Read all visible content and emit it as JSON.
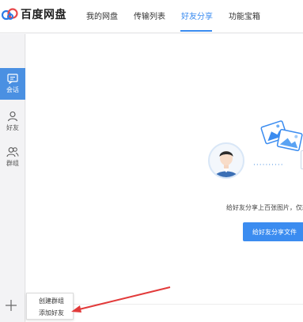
{
  "app": {
    "logo_text": "百度网盘",
    "brand_color": "#3b8cf0"
  },
  "nav": {
    "tabs": [
      {
        "label": "我的网盘",
        "active": false
      },
      {
        "label": "传输列表",
        "active": false
      },
      {
        "label": "好友分享",
        "active": true
      },
      {
        "label": "功能宝箱",
        "active": false
      }
    ]
  },
  "sidebar": {
    "items": [
      {
        "label": "会话",
        "icon": "chat-icon",
        "active": true
      },
      {
        "label": "好友",
        "icon": "person-icon",
        "active": false
      },
      {
        "label": "群组",
        "icon": "group-icon",
        "active": false
      }
    ],
    "add_icon": "plus-icon"
  },
  "main": {
    "dots": "··········",
    "caption": "给好友分享上百张图片，仅耗",
    "share_button": "给好友分享文件"
  },
  "popup": {
    "items": [
      "创建群组",
      "添加好友"
    ]
  },
  "annotation": {
    "arrow_color": "#e23a3a"
  }
}
